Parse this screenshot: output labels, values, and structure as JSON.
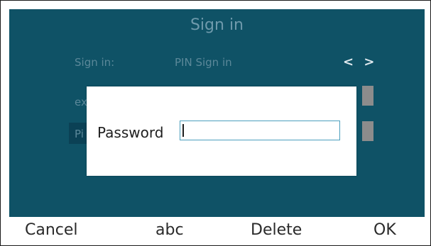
{
  "screen": {
    "title": "Sign in",
    "rows": [
      {
        "label": "Sign in:",
        "value": "PIN Sign in"
      },
      {
        "label": "ex",
        "value": ""
      },
      {
        "label": "Pi",
        "value": ""
      }
    ],
    "nav_arrows": "< >"
  },
  "dialog": {
    "label": "Password",
    "value": ""
  },
  "softkeys": {
    "cancel": "Cancel",
    "abc": "abc",
    "delete": "Delete",
    "ok": "OK"
  },
  "colors": {
    "screen_bg": "#0f5266",
    "input_border": "#4b9fbd"
  }
}
